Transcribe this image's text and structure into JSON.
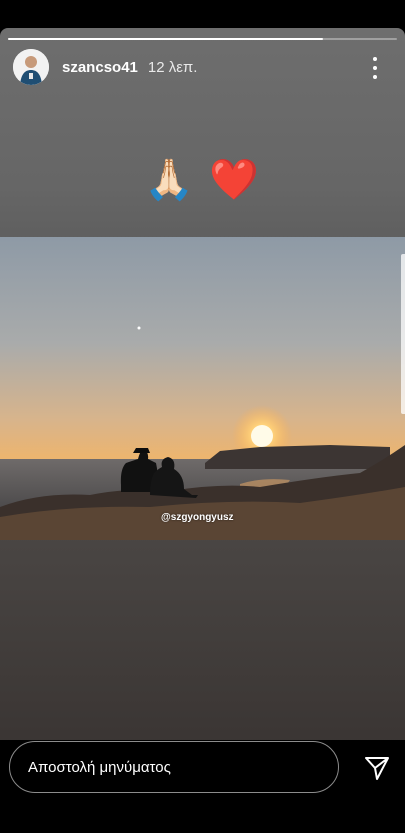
{
  "story": {
    "username": "szancso41",
    "timestamp": "12 λεπ.",
    "progress": 0.81,
    "emojis": "🙏🏻 ❤️",
    "mention": "@szgyongyusz"
  },
  "footer": {
    "message_placeholder": "Αποστολή μηνύματος"
  },
  "icons": {
    "more": "more-vertical-icon",
    "send": "send-icon"
  }
}
